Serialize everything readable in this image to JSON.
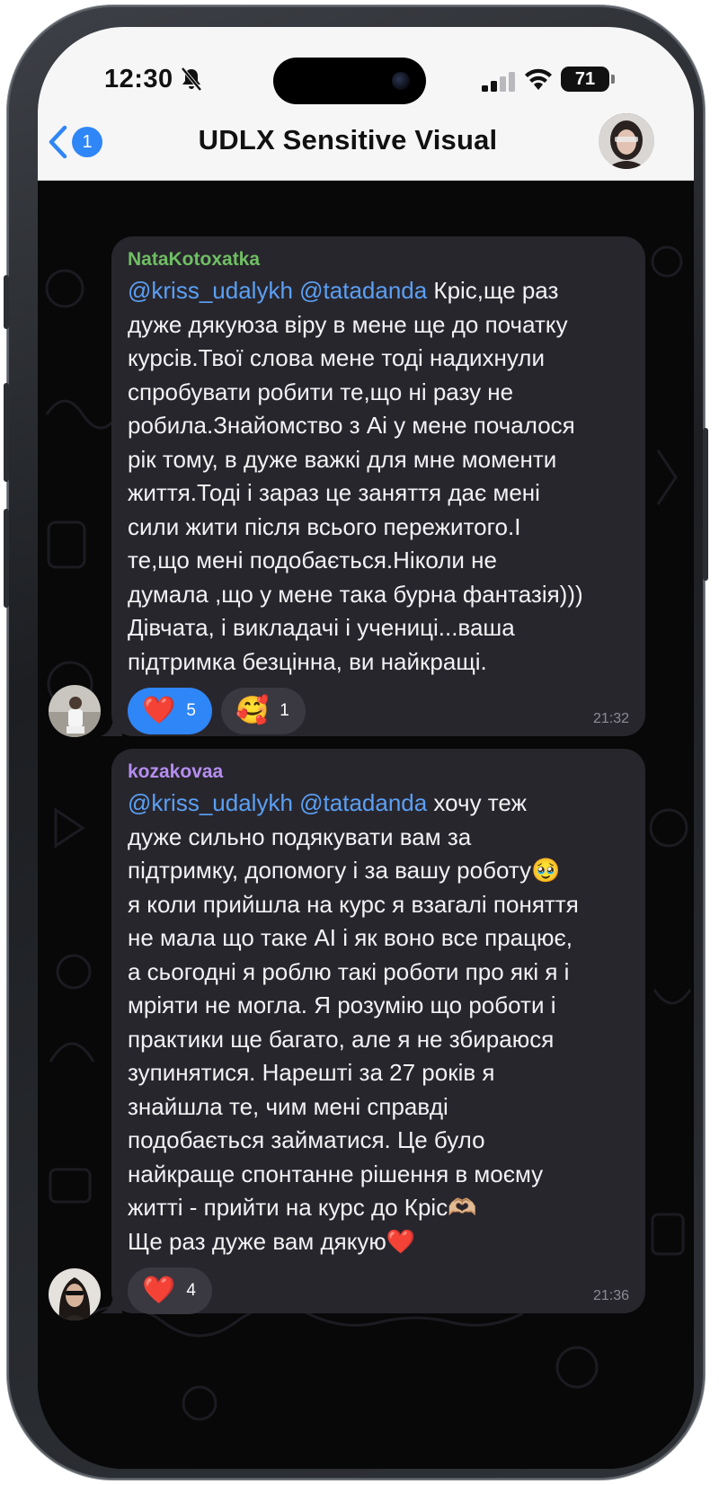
{
  "status_bar": {
    "time": "12:30",
    "battery": "71"
  },
  "header": {
    "back_badge": "1",
    "title": "UDLX Sensitive Visual"
  },
  "messages": [
    {
      "sender": "NataKotoxatka",
      "sender_color": "#6fbf63",
      "mention_1": "@kriss_udalykh",
      "mention_2": "@tatadanda",
      "text": " Кріс,ще раз\nдуже дякуюза віру в мене ще до початку\nкурсів.Твої слова мене тоді надихнули\nспробувати робити те,що ні разу не\nробила.Знайомство з Аі у мене почалося\nрік тому, в дуже важкі для мне моменти\nжиття.Тоді і зараз це заняття дає мені\nсили жити після всього пережитого.І\nте,що мені подобається.Ніколи не\nдумала ,що у мене така бурна фантазія)))\nДівчата, і викладачі і учениці...ваша\nпідтримка безцінна, ви найкращі.",
      "reactions": [
        {
          "emoji": "❤️",
          "count": "5",
          "active": true
        },
        {
          "emoji": "🥰",
          "count": "1",
          "active": false
        }
      ],
      "time": "21:32"
    },
    {
      "sender": "kozakovaa",
      "sender_color": "#b58ef0",
      "mention_1": "@kriss_udalykh",
      "mention_2": "@tatadanda",
      "text": " хочу теж\nдуже сильно подякувати вам за\nпідтримку, допомогу і за вашу роботу🥹\nя коли прийшла на курс я взагалі поняття\nне мала що таке АІ і як воно все працює,\nа сьогодні я роблю такі роботи про які я і\nмріяти не могла. Я розумію що роботи і\nпрактики ще багато, але я не збираюся\nзупинятися. Нарешті за 27 років я\nзнайшла те, чим мені справді\nподобається займатися. Це було\nнайкраще спонтанне рішення в моєму\nжитті - прийти на курс до Кріс🫶🏼\nЩе раз дуже вам дякую❤️",
      "reactions": [
        {
          "emoji": "❤️",
          "count": "4",
          "active": false
        }
      ],
      "time": "21:36"
    }
  ]
}
